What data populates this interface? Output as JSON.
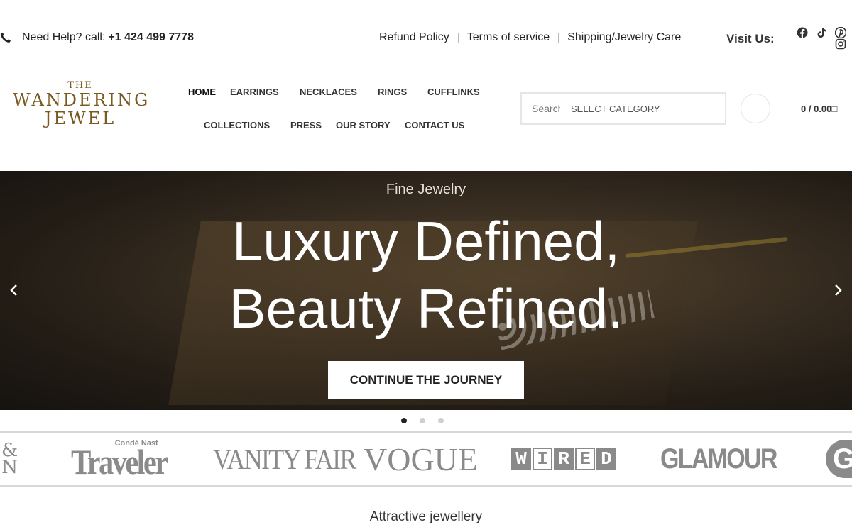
{
  "topbar": {
    "help_text": "Need Help? call:",
    "phone": "+1 424 499 7778",
    "links": [
      "Refund Policy",
      "Terms of service",
      "Shipping/Jewelry Care"
    ],
    "visit_label": "Visit Us:"
  },
  "brand": {
    "line1": "THE",
    "line2": "WANDERING",
    "line3": "JEWEL",
    "color": "#7a5a20"
  },
  "nav": {
    "row1": [
      "HOME",
      "EARRINGS",
      "NECKLACES",
      "RINGS",
      "CUFFLINKS"
    ],
    "row2": [
      "COLLECTIONS",
      "PRESS",
      "OUR STORY",
      "CONTACT US"
    ]
  },
  "search": {
    "placeholder": "Search for products",
    "category": "SELECT CATEGORY"
  },
  "cart": {
    "label": "0 / 0.00"
  },
  "hero": {
    "eyebrow": "Fine Jewelry",
    "line1": "Luxury Defined,",
    "line2": "Beauty Refined.",
    "cta": "CONTINUE THE JOURNEY",
    "slides": 3,
    "active_slide": 1
  },
  "press": {
    "and_top": "&",
    "and_bottom": "N",
    "traveler_small": "Condé Nast",
    "traveler": "Traveler",
    "vanity_fair": "VANITY FAIR",
    "vogue": "VOGUE",
    "wired": [
      "W",
      "I",
      "R",
      "E",
      "D"
    ],
    "glamour": "GLAMOUR",
    "g": "G"
  },
  "section": {
    "title": "Attractive jewellery"
  },
  "icons": {
    "phone": "phone-icon",
    "facebook": "facebook-icon",
    "tiktok": "tiktok-icon",
    "pinterest": "pinterest-icon",
    "instagram": "instagram-icon",
    "search": "search-icon",
    "cart": "cart-icon",
    "prev": "chevron-left-icon",
    "next": "chevron-right-icon"
  }
}
